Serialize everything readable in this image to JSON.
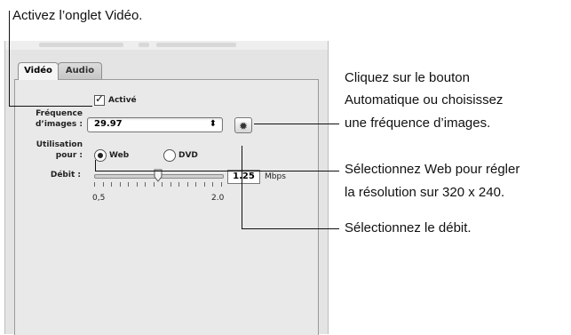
{
  "callouts": {
    "video_tab": "Activez l’onglet Vidéo.",
    "auto_line1": "Cliquez sur le bouton",
    "auto_line2": "Automatique ou choisissez",
    "auto_line3": "une fréquence d’images.",
    "web_line1": "Sélectionnez Web pour régler",
    "web_line2": "la résolution sur 320 x 240.",
    "bitrate": "Sélectionnez le débit."
  },
  "tabs": [
    {
      "label": "Vidéo",
      "active": true
    },
    {
      "label": "Audio",
      "active": false
    }
  ],
  "form": {
    "enabled_label": "Activé",
    "enabled_checked": true,
    "framerate_label_1": "Fréquence",
    "framerate_label_2": "d’images :",
    "framerate_value": "29.97",
    "framerate_arrows": "⬍",
    "auto_button_icon": "gear-icon",
    "usage_label_1": "Utilisation",
    "usage_label_2": "pour :",
    "usage_web": "Web",
    "usage_dvd": "DVD",
    "usage_selected": "Web",
    "bitrate_label": "Débit :",
    "bitrate_min": "0,5",
    "bitrate_max": "2.0",
    "bitrate_value": "1.25",
    "bitrate_unit": "Mbps",
    "bitrate_level": 0.5
  }
}
